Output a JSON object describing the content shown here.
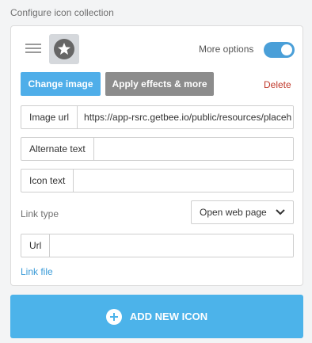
{
  "section": {
    "title": "Configure icon collection"
  },
  "icon_item": {
    "thumbnail_icon": "star-icon",
    "more_options_label": "More options",
    "more_options_enabled": true,
    "change_image_label": "Change image",
    "apply_effects_label": "Apply effects & more",
    "delete_label": "Delete",
    "fields": {
      "image_url": {
        "label": "Image url",
        "value": "https://app-rsrc.getbee.io/public/resources/placeh"
      },
      "alternate_text": {
        "label": "Alternate text",
        "value": ""
      },
      "icon_text": {
        "label": "Icon text",
        "value": ""
      },
      "url": {
        "label": "Url",
        "value": ""
      }
    },
    "link_type": {
      "label": "Link type",
      "selected": "Open web page"
    },
    "link_file_label": "Link file"
  },
  "add_button": {
    "label": "ADD NEW ICON"
  },
  "colors": {
    "accent": "#4cb3ea",
    "toggle_on": "#4a9fd8",
    "delete": "#c0392b",
    "secondary_button": "#8c8c8c"
  }
}
